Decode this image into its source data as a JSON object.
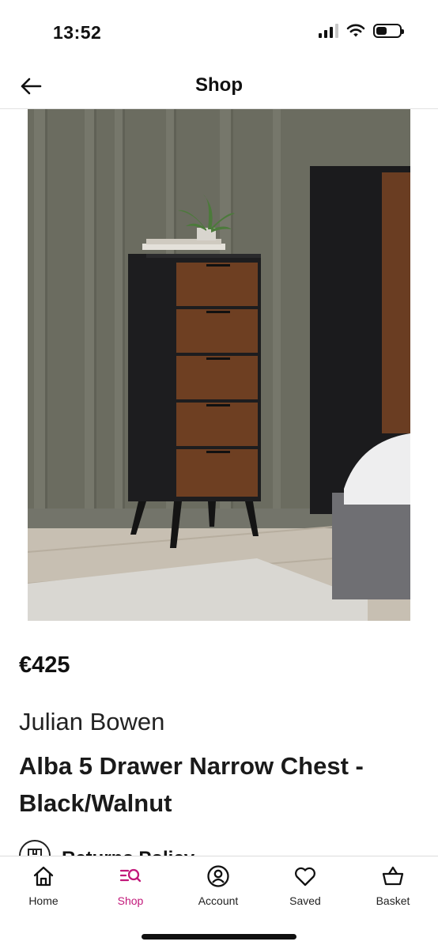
{
  "status_bar": {
    "time": "13:52"
  },
  "header": {
    "title": "Shop"
  },
  "product": {
    "price": "€425",
    "brand": "Julian Bowen",
    "title": "Alba 5 Drawer Narrow Chest - Black/Walnut",
    "returns_label": "Returns Policy"
  },
  "tabs": [
    {
      "label": "Home",
      "icon": "home-icon"
    },
    {
      "label": "Shop",
      "icon": "shop-search-icon",
      "active": true
    },
    {
      "label": "Account",
      "icon": "account-icon"
    },
    {
      "label": "Saved",
      "icon": "heart-icon"
    },
    {
      "label": "Basket",
      "icon": "basket-icon"
    }
  ],
  "colors": {
    "accent": "#c2187a",
    "text": "#111111"
  }
}
